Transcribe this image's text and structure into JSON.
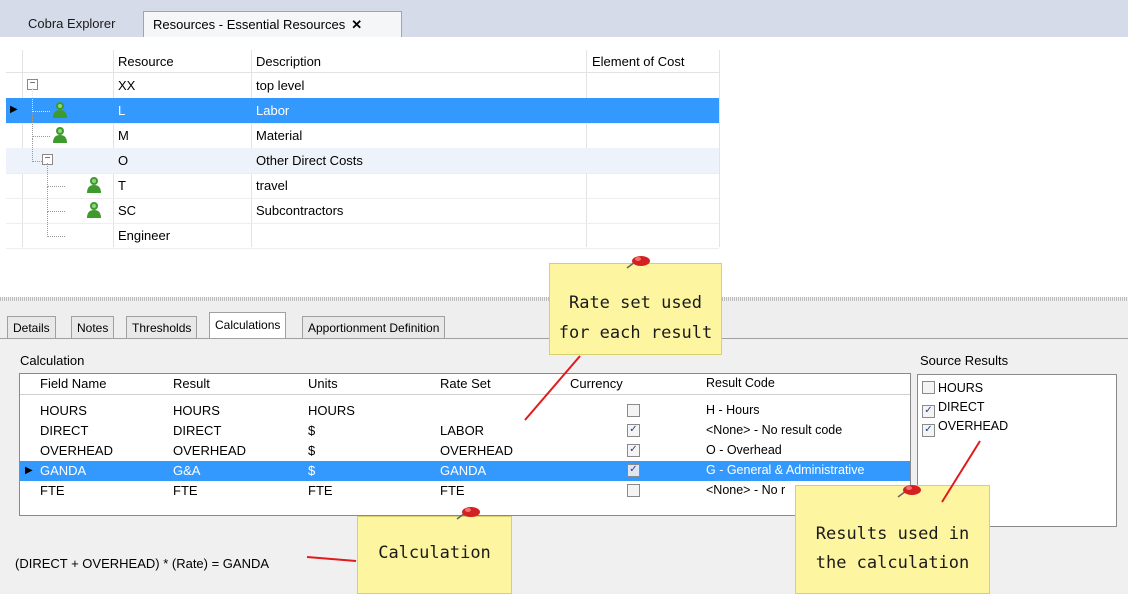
{
  "window": {
    "tabs": [
      {
        "label": "Cobra Explorer"
      },
      {
        "label": "Resources - Essential Resources",
        "close": "✕"
      }
    ]
  },
  "resource_grid": {
    "columns": [
      "Resource",
      "Description",
      "Element of Cost"
    ],
    "rows": [
      {
        "resource": "XX",
        "description": "top level"
      },
      {
        "resource": "L",
        "description": "Labor"
      },
      {
        "resource": "M",
        "description": "Material"
      },
      {
        "resource": "O",
        "description": "Other Direct Costs"
      },
      {
        "resource": "T",
        "description": "travel"
      },
      {
        "resource": "SC",
        "description": "Subcontractors"
      },
      {
        "resource": "Engineer",
        "description": ""
      }
    ]
  },
  "property_tabs": [
    "Details",
    "Notes",
    "Thresholds",
    "Calculations",
    "Apportionment Definition"
  ],
  "calculation": {
    "label": "Calculation",
    "columns": [
      "Field Name",
      "Result",
      "Units",
      "Rate Set",
      "Currency",
      "Result Code"
    ],
    "rows": [
      {
        "field": "HOURS",
        "result": "HOURS",
        "units": "HOURS",
        "rate_set": "",
        "currency": false,
        "code": "H - Hours"
      },
      {
        "field": "DIRECT",
        "result": "DIRECT",
        "units": "$",
        "rate_set": "LABOR",
        "currency": true,
        "code": "<None> - No result code"
      },
      {
        "field": "OVERHEAD",
        "result": "OVERHEAD",
        "units": "$",
        "rate_set": "OVERHEAD",
        "currency": true,
        "code": "O - Overhead"
      },
      {
        "field": "GANDA",
        "result": "G&A",
        "units": "$",
        "rate_set": "GANDA",
        "currency": true,
        "code": "G - General & Administrative"
      },
      {
        "field": "FTE",
        "result": "FTE",
        "units": "FTE",
        "rate_set": "FTE",
        "currency": false,
        "code": "<None> - No r"
      }
    ],
    "formula": "(DIRECT + OVERHEAD) * (Rate) = GANDA"
  },
  "source_results": {
    "label": "Source Results",
    "items": [
      {
        "label": "HOURS",
        "checked": false
      },
      {
        "label": "DIRECT",
        "checked": true
      },
      {
        "label": "OVERHEAD",
        "checked": true
      }
    ]
  },
  "annotations": {
    "rate_set_note": [
      "Rate set used",
      "for each result"
    ],
    "calculation_note": "Calculation",
    "results_note": [
      "Results used in",
      "the calculation"
    ]
  },
  "colors": {
    "selection": "#3399ff",
    "note": "#fdf5a0",
    "arrow": "#e01b1b",
    "person_icon": "#3f9a2e"
  },
  "icons": {
    "tree_node": "person-icon",
    "expander": "collapse-box-icon",
    "row_pointer": "row-pointer-icon",
    "pin": "pushpin-icon"
  }
}
